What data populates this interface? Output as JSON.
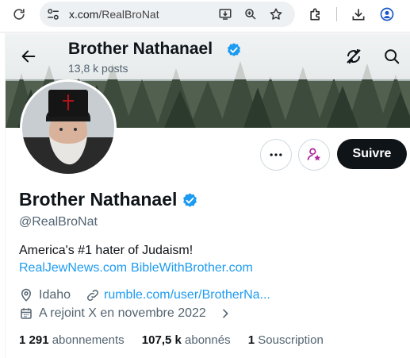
{
  "browser": {
    "url_host": "x.com",
    "url_path": "/RealBroNat"
  },
  "header": {
    "name": "Brother Nathanael",
    "posts": "13,8 k posts"
  },
  "profile": {
    "name": "Brother Nathanael",
    "handle": "@RealBroNat",
    "bio": "America's #1 hater of Judaism!",
    "bio_links": [
      "RealJewNews.com",
      "BibleWithBrother.com"
    ],
    "location": "Idaho",
    "website": "rumble.com/user/BrotherNa...",
    "joined": "A rejoint X en novembre 2022"
  },
  "actions": {
    "follow_label": "Suivre"
  },
  "stats": {
    "following_count": "1 291",
    "following_label": "abonnements",
    "followers_count": "107,5 k",
    "followers_label": "abonnés",
    "subscriptions_count": "1",
    "subscriptions_label": "Souscription"
  },
  "colors": {
    "accent": "#1d9bf0",
    "verified": "#1d9bf0",
    "subscribe_accent": "#b0249e",
    "follow_bg": "#0f1419"
  },
  "icons": [
    "reload-icon",
    "site-settings-icon",
    "install-app-icon",
    "zoom-icon",
    "bookmark-star-icon",
    "extensions-icon",
    "download-icon",
    "profile-icon",
    "back-arrow-icon",
    "verified-badge-icon",
    "sync-off-icon",
    "search-icon",
    "more-icon",
    "subscribe-icon",
    "location-icon",
    "link-icon",
    "calendar-icon",
    "chevron-right-icon"
  ]
}
